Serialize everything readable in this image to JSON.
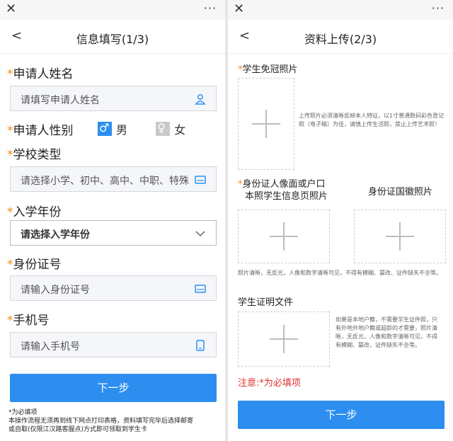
{
  "left": {
    "close": "✕",
    "more": "···",
    "back": "<",
    "title": "信息填写(1/3)",
    "req_mark": "*",
    "name_label": "申请人姓名",
    "name_placeholder": "请填写申请人姓名",
    "gender_label": "申请人性别",
    "gender_male": "男",
    "gender_female": "女",
    "school_label": "学校类型",
    "school_placeholder": "请选择小学、初中、高中、中职、特殊",
    "year_label": "入学年份",
    "year_value": "请选择入学年份",
    "id_label": "身份证号",
    "id_placeholder": "请输入身份证号",
    "phone_label": "手机号",
    "phone_placeholder": "请输入手机号",
    "next": "下一步",
    "note_line1": "*为必填项",
    "note_line2": "本操作流程无须再到线下网点打印表格，资料填写完毕后选择邮寄",
    "note_line3": "或自取(仅限江汉路客服点)方式即可领取到学生卡"
  },
  "right": {
    "close": "✕",
    "more": "···",
    "back": "<",
    "title": "资料上传(2/3)",
    "req_mark": "*",
    "photo_label": "学生免冠照片",
    "photo_hint": "上传照片必须清晰反映本人特征，以1寸普通数码彩色登记照（电子稿）为佳，请慎上传生活照，禁止上传艺术照！",
    "id_front_label_1": "身份证人像面或户口",
    "id_front_label_2": "本照学生信息页照片",
    "id_back_label": "身份证国徽照片",
    "id_hint": "照片清晰，无反光，人像和数字清晰可见，不得有模糊、篡改、证件缺失不全等。",
    "proof_label": "学生证明文件",
    "proof_hint": "如果是本地户籍，不需要学生证件照，只有外地外地户籍或超龄的才需要，照片清晰，无反光，人像和数字清晰可见，不得有模糊、篡改，证件缺失不全等。",
    "attention": "注意:*为必填项",
    "next": "下一步"
  }
}
